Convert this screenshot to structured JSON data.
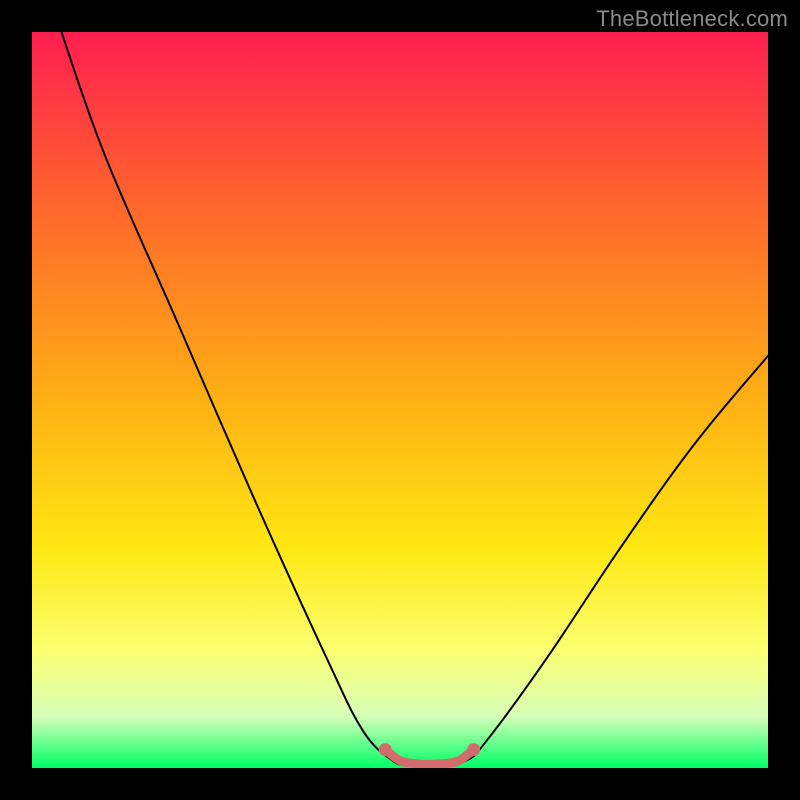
{
  "watermark": "TheBottleneck.com",
  "chart_data": {
    "type": "line",
    "title": "",
    "xlabel": "",
    "ylabel": "",
    "xlim": [
      0,
      100
    ],
    "ylim": [
      0,
      100
    ],
    "gradient_stops": [
      {
        "offset": 0,
        "color": "#ff1e50"
      },
      {
        "offset": 25,
        "color": "#ff6a2a"
      },
      {
        "offset": 50,
        "color": "#ffb014"
      },
      {
        "offset": 70,
        "color": "#ffe712"
      },
      {
        "offset": 84,
        "color": "#fbff70"
      },
      {
        "offset": 93,
        "color": "#d6ffb8"
      },
      {
        "offset": 100,
        "color": "#00ff66"
      }
    ],
    "series": [
      {
        "name": "bottleneck-curve",
        "color": "#000000",
        "points": [
          {
            "x": 4,
            "y": 100
          },
          {
            "x": 10,
            "y": 83
          },
          {
            "x": 20,
            "y": 60
          },
          {
            "x": 30,
            "y": 37
          },
          {
            "x": 40,
            "y": 15
          },
          {
            "x": 45,
            "y": 5
          },
          {
            "x": 49,
            "y": 1
          },
          {
            "x": 51,
            "y": 0.5
          },
          {
            "x": 55,
            "y": 0.5
          },
          {
            "x": 59,
            "y": 1
          },
          {
            "x": 62,
            "y": 4
          },
          {
            "x": 70,
            "y": 15
          },
          {
            "x": 80,
            "y": 30
          },
          {
            "x": 90,
            "y": 44
          },
          {
            "x": 100,
            "y": 56
          }
        ]
      },
      {
        "name": "valley-highlight",
        "color": "#d26b6b",
        "points": [
          {
            "x": 48,
            "y": 2.5
          },
          {
            "x": 50,
            "y": 1
          },
          {
            "x": 52,
            "y": 0.6
          },
          {
            "x": 54,
            "y": 0.5
          },
          {
            "x": 56,
            "y": 0.6
          },
          {
            "x": 58,
            "y": 1
          },
          {
            "x": 60,
            "y": 2.5
          }
        ]
      }
    ]
  }
}
